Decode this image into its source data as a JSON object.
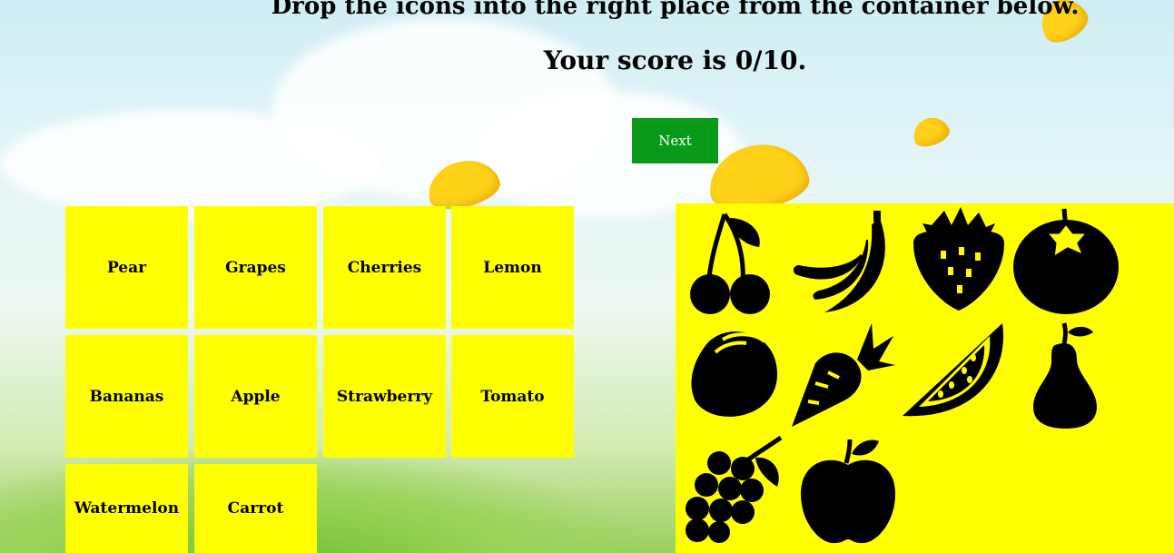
{
  "header": {
    "instruction": "Drop the icons into the right place from the container below.",
    "score_text": "Your score is 0/10."
  },
  "next_button": {
    "label": "Next"
  },
  "labels": [
    "Pear",
    "Grapes",
    "Cherries",
    "Lemon",
    "Bananas",
    "Apple",
    "Strawberry",
    "Tomato",
    "Watermelon",
    "Carrot"
  ],
  "icons": [
    "cherries-icon",
    "bananas-icon",
    "strawberry-icon",
    "tomato-icon",
    "lemon-icon",
    "carrot-icon",
    "watermelon-icon",
    "pear-icon",
    "grapes-icon",
    "apple-icon"
  ],
  "colors": {
    "card": "#ffff00",
    "drop_zone": "#ffff00",
    "button": "#0a9a1a",
    "icon": "#000000"
  }
}
